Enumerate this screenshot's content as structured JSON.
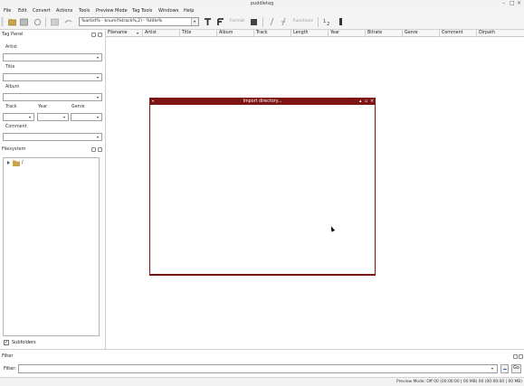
{
  "window": {
    "title": "puddletag",
    "controls": [
      "–",
      "□",
      "×"
    ]
  },
  "menubar": {
    "items": [
      "File",
      "Edit",
      "Convert",
      "Actions",
      "Tools",
      "Preview Mode",
      "Tag Tools",
      "Windows",
      "Help"
    ]
  },
  "toolbar": {
    "pattern_value": "%artist% - $num(%track%,2) - %title%",
    "format_label": "Format",
    "functions_label": "Functions"
  },
  "tag_panel": {
    "title": "Tag Panel",
    "artist_label": "Artist",
    "title_label": "Title",
    "album_label": "Album",
    "track_label": "Track",
    "year_label": "Year",
    "genre_label": "Genre",
    "comment_label": "Comment"
  },
  "filesystem": {
    "title": "Filesystem",
    "root": "/",
    "subfolders_label": "Subfolders",
    "subfolders_checked": true
  },
  "table": {
    "columns": [
      "Filename",
      "Artist",
      "Title",
      "Album",
      "Track",
      "Length",
      "Year",
      "Bitrate",
      "Genre",
      "Comment",
      "Dirpath"
    ]
  },
  "dialog": {
    "title": "Import directory...",
    "controls": [
      "▴",
      "▫",
      "×"
    ]
  },
  "filter": {
    "section_title": "Filter",
    "field_label": "Filter:",
    "value": "",
    "go_label": "Go"
  },
  "status": {
    "text": "Preview Mode: Off  00 (00:00:00 | 00 MB)  00 (00:00:00 | 00 MB)"
  },
  "colors": {
    "dialog_accent": "#7e1414",
    "folder": "#c9a54a"
  }
}
